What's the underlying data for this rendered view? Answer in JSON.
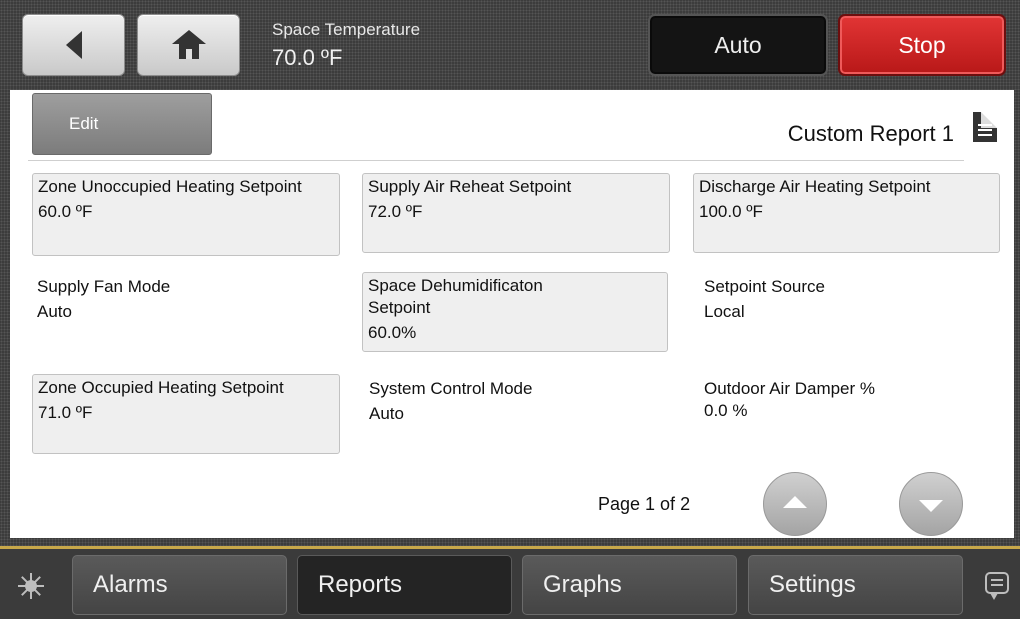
{
  "header": {
    "space_temperature_label": "Space Temperature",
    "space_temperature_value": "70.0 ºF",
    "mode_button": "Auto",
    "stop_button": "Stop"
  },
  "report": {
    "edit_label": "Edit",
    "title": "Custom Report 1",
    "cells": [
      {
        "label": "Zone Unoccupied Heating Setpoint",
        "value": "60.0 ºF"
      },
      {
        "label": "Supply Air Reheat Setpoint",
        "value": "72.0 ºF"
      },
      {
        "label": "Discharge Air Heating Setpoint",
        "value": "100.0 ºF"
      },
      {
        "label": "Supply Fan Mode",
        "value": "Auto"
      },
      {
        "label": "Space Dehumidificaton Setpoint",
        "value": "60.0%"
      },
      {
        "label": "Setpoint Source",
        "value": "Local"
      },
      {
        "label": "Zone Occupied Heating Setpoint",
        "value": "71.0 ºF"
      },
      {
        "label": "System Control Mode",
        "value": "Auto"
      },
      {
        "label": "Outdoor Air Damper %",
        "value": "0.0 %"
      }
    ],
    "page_text": "Page 1 of 2"
  },
  "nav": {
    "tabs": [
      "Alarms",
      "Reports",
      "Graphs",
      "Settings"
    ],
    "active_tab": "Reports"
  },
  "colors": {
    "stop_red": "#d62828",
    "nav_accent": "#c8a84a",
    "cell_bg": "#efefef"
  },
  "icons": [
    "back-arrow-icon",
    "home-icon",
    "document-icon",
    "chevron-up-icon",
    "chevron-down-icon",
    "brightness-icon",
    "chat-icon"
  ]
}
